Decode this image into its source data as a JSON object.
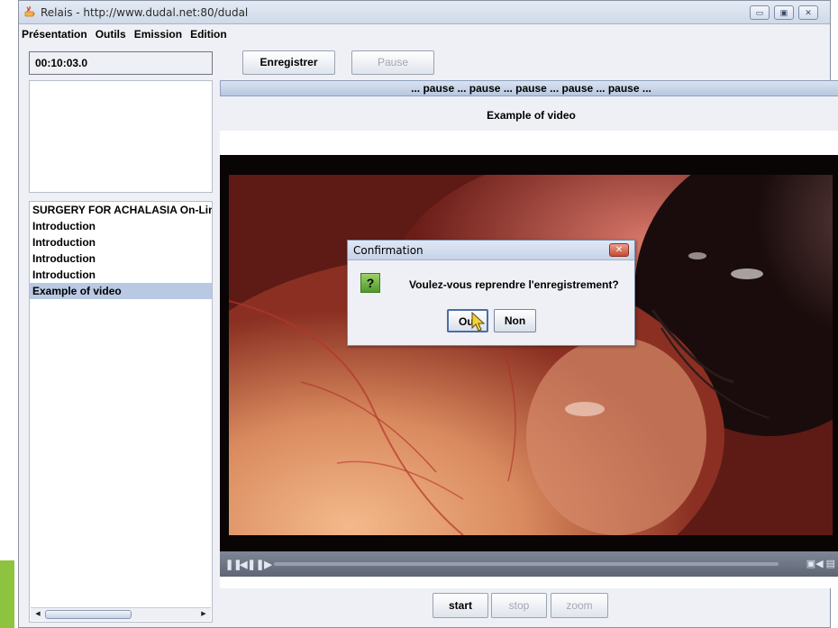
{
  "window": {
    "title": "Relais - http://www.dudal.net:80/dudal",
    "controls": {
      "minimize": "▭",
      "maximize": "▣",
      "close": "✕"
    }
  },
  "menu": [
    "Présentation",
    "Outils",
    "Emission",
    "Edition"
  ],
  "timer": "00:10:03.0",
  "toolbar": {
    "record_label": "Enregistrer",
    "pause_label": "Pause"
  },
  "status_banner": "... pause ... pause ... pause ... pause ... pause ...",
  "video_title": "Example of video",
  "playlist": [
    "SURGERY FOR ACHALASIA On-Lin",
    "Introduction",
    "Introduction",
    "Introduction",
    "Introduction",
    "Example of video"
  ],
  "playlist_selected_index": 5,
  "player_controls": {
    "pause_icon": "❚❚",
    "prev_icon": "◀❚",
    "next_icon": "❚▶",
    "right_icons": "▣◀ ▤"
  },
  "bottom_buttons": {
    "start_label": "start",
    "stop_label": "stop",
    "zoom_label": "zoom"
  },
  "dialog": {
    "title": "Confirmation",
    "close_glyph": "✕",
    "icon_glyph": "?",
    "message": "Voulez-vous reprendre l'enregistrement?",
    "yes_label": "Oui",
    "no_label": "Non"
  },
  "colors": {
    "accent_selection": "#b9c9e4",
    "dialog_icon_green": "#6fb83f",
    "side_tab_green": "#8ec33f",
    "close_red": "#c74a33"
  }
}
